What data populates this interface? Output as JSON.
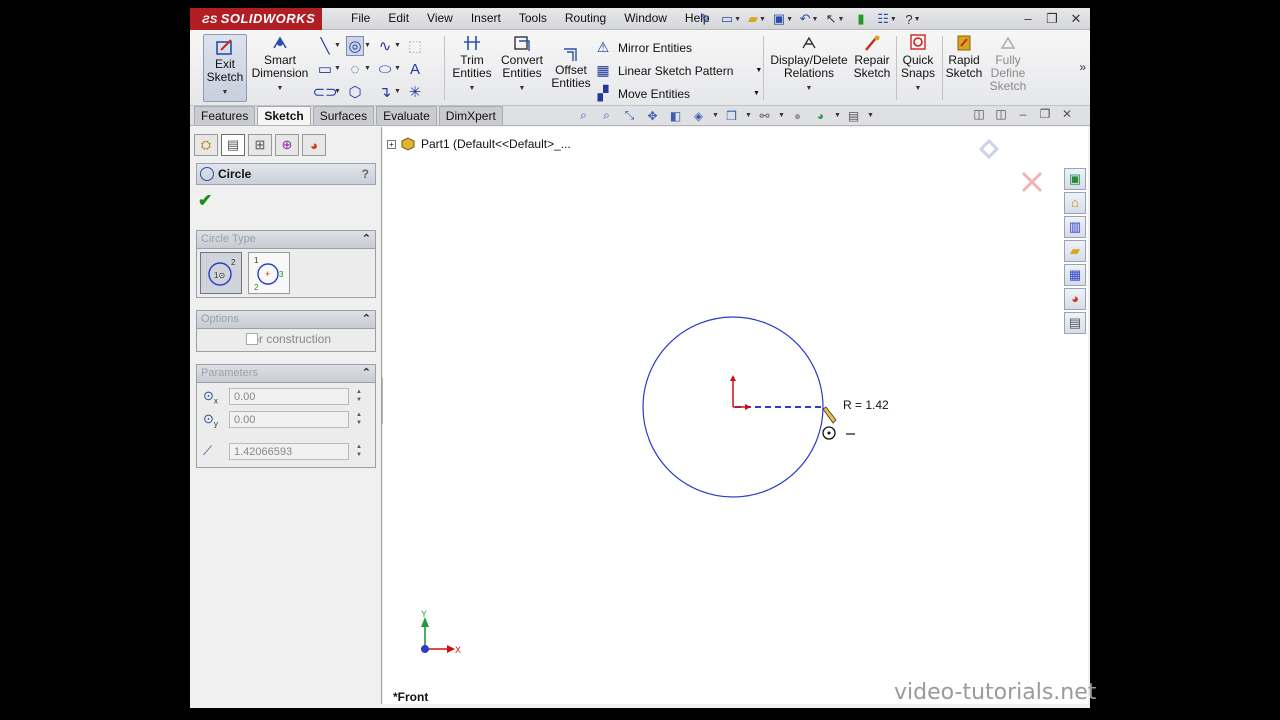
{
  "app": {
    "logo_text": "SOLIDWORKS"
  },
  "menu": [
    "File",
    "Edit",
    "View",
    "Insert",
    "Tools",
    "Routing",
    "Window",
    "Help"
  ],
  "command_manager": {
    "exit_sketch": "Exit\nSketch",
    "smart_dimension": "Smart\nDimension",
    "trim_entities": "Trim\nEntities",
    "convert_entities": "Convert\nEntities",
    "offset_entities": "Offset\nEntities",
    "mirror_entities": "Mirror Entities",
    "linear_sketch_pattern": "Linear Sketch Pattern",
    "move_entities": "Move Entities",
    "display_delete_relations": "Display/Delete\nRelations",
    "repair_sketch": "Repair\nSketch",
    "quick_snaps": "Quick\nSnaps",
    "rapid_sketch": "Rapid\nSketch",
    "fully_define_sketch": "Fully\nDefine\nSketch"
  },
  "tabs": [
    {
      "label": "Features",
      "active": false
    },
    {
      "label": "Sketch",
      "active": true
    },
    {
      "label": "Surfaces",
      "active": false
    },
    {
      "label": "Evaluate",
      "active": false
    },
    {
      "label": "DimXpert",
      "active": false
    }
  ],
  "property_manager": {
    "title": "Circle",
    "help": "?",
    "circle_type_header": "Circle Type",
    "options_header": "Options",
    "for_construction": "For construction",
    "parameters_header": "Parameters",
    "center_x": "0.00",
    "center_y": "0.00",
    "radius": "1.42066593"
  },
  "graphics": {
    "tree_item": "Part1  (Default<<Default>_...",
    "radius_readout": "R = 1.42",
    "view_label": "*Front",
    "triad_x": "X",
    "triad_y": "Y"
  },
  "watermark": "video-tutorials.net",
  "colors": {
    "brand_red": "#b01e23",
    "sketch_blue": "#2a3cc8",
    "origin_red": "#d01010"
  }
}
